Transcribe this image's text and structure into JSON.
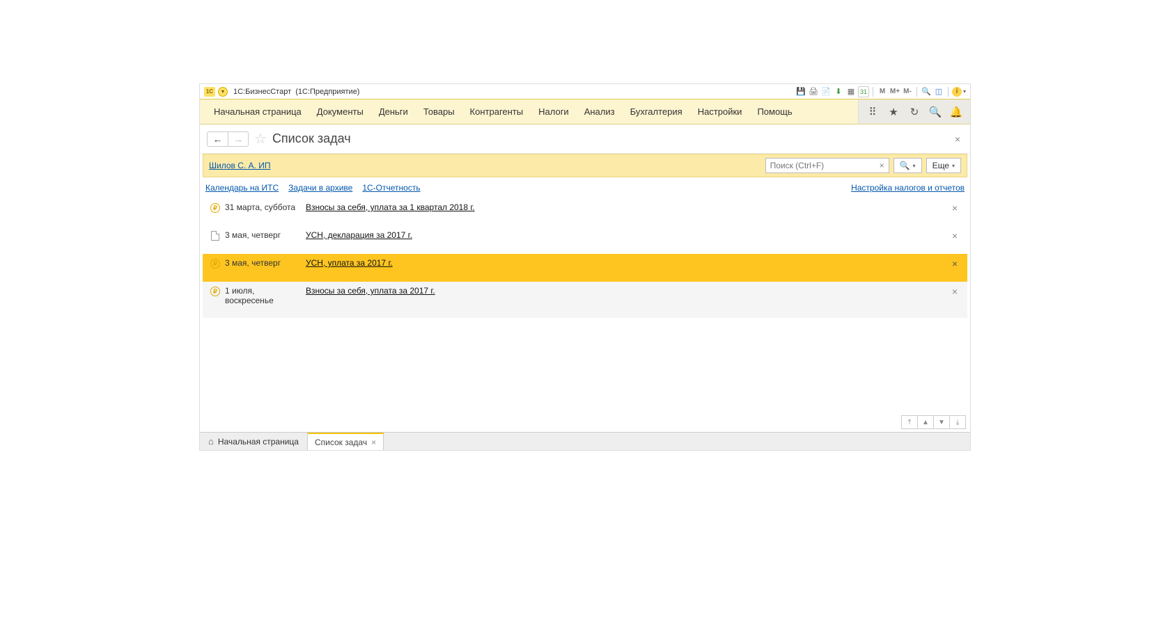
{
  "titlebar": {
    "app": "1С:БизнесСтарт",
    "platform": "(1С:Предприятие)",
    "m_labels": [
      "M",
      "M+",
      "M-"
    ]
  },
  "mainmenu": {
    "items": [
      "Начальная страница",
      "Документы",
      "Деньги",
      "Товары",
      "Контрагенты",
      "Налоги",
      "Анализ",
      "Бухгалтерия",
      "Настройки",
      "Помощь"
    ]
  },
  "page": {
    "title": "Список задач"
  },
  "filter": {
    "org": "Шилов С. А. ИП",
    "search_placeholder": "Поиск (Ctrl+F)",
    "more_label": "Еще"
  },
  "sublinks": {
    "left": [
      "Календарь на ИТС",
      "Задачи в архиве",
      "1С-Отчетность"
    ],
    "right": "Настройка налогов и отчетов"
  },
  "tasks": [
    {
      "icon": "ruble",
      "date": "31 марта, суббота",
      "desc": "Взносы за себя, уплата за 1 квартал 2018 г.",
      "selected": false,
      "alt": false
    },
    {
      "icon": "doc",
      "date": "3 мая, четверг",
      "desc": "УСН, декларация за 2017 г.",
      "selected": false,
      "alt": false
    },
    {
      "icon": "ruble",
      "date": "3 мая, четверг",
      "desc": "УСН, уплата за 2017 г.",
      "selected": true,
      "alt": false
    },
    {
      "icon": "ruble",
      "date": "1 июля, воскресенье",
      "desc": "Взносы за себя, уплата за 2017 г.",
      "selected": false,
      "alt": true
    }
  ],
  "tabs": {
    "home": "Начальная страница",
    "active": "Список задач"
  }
}
